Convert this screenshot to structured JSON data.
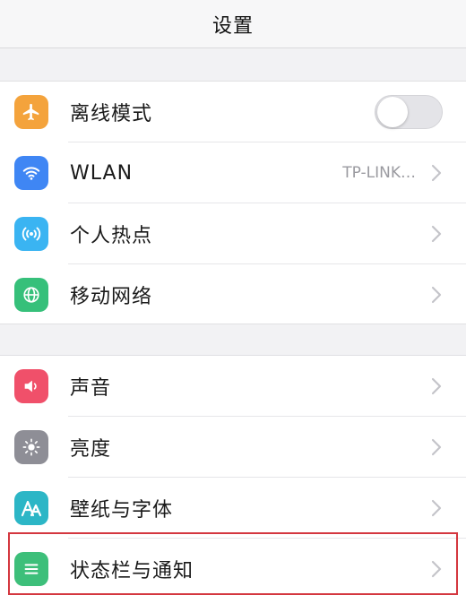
{
  "header": {
    "title": "设置"
  },
  "group1": {
    "items": [
      {
        "label": "离线模式",
        "icon": "airplane-icon",
        "icon_color": "#f4a33c",
        "control": "toggle",
        "toggle_on": false
      },
      {
        "label": "WLAN",
        "icon": "wifi-icon",
        "icon_color": "#3f86f4",
        "value": "TP-LINK…",
        "control": "chevron"
      },
      {
        "label": "个人热点",
        "icon": "hotspot-icon",
        "icon_color": "#3ab4f2",
        "control": "chevron"
      },
      {
        "label": "移动网络",
        "icon": "globe-icon",
        "icon_color": "#36c07a",
        "control": "chevron"
      }
    ]
  },
  "group2": {
    "items": [
      {
        "label": "声音",
        "icon": "speaker-icon",
        "icon_color": "#f0506a",
        "control": "chevron"
      },
      {
        "label": "亮度",
        "icon": "sun-icon",
        "icon_color": "#8e8e96",
        "control": "chevron"
      },
      {
        "label": "壁纸与字体",
        "icon": "font-icon",
        "icon_color": "#2cb6c6",
        "control": "chevron"
      },
      {
        "label": "状态栏与通知",
        "icon": "status-bar-icon",
        "icon_color": "#3dbf7a",
        "control": "chevron",
        "highlighted": true
      }
    ]
  },
  "colors": {
    "highlight": "#d4373f",
    "background": "#f2f2f4"
  }
}
